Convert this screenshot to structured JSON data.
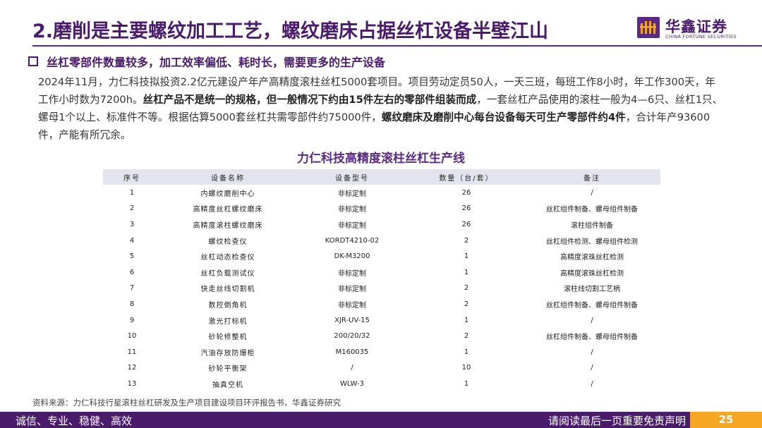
{
  "header": {
    "title": "2.磨削是主要螺纹加工工艺，螺纹磨床占据丝杠设备半壁江山",
    "logo_cn": "华鑫证券",
    "logo_en": "CHINA FORTUNE SECURITIES"
  },
  "subheading": "丝杠零部件数量较多，加工效率偏低、耗时长，需要更多的生产设备",
  "paragraph": {
    "p1": "2024年11月，力仁科技拟投资2.2亿元建设产年产高精度滚柱丝杠5000套项目。项目劳动定员50人，一天三班，每班工作8小时，年工作300天，年工作小时数为7200h。",
    "b1": "丝杠产品不是统一的规格，但一般情况下约由15件左右的零部件组装而成",
    "p2": "，一套丝杠产品使用的滚柱一般为4—6只、丝杠1只、螺母1个以上、标准件不等。根据估算5000套丝杠共需零部件约75000件，",
    "b2": "螺纹磨床及磨削中心每台设备每天可生产零部件约4件",
    "p3": "，合计年产93600件，产能有所冗余。"
  },
  "table": {
    "title": "力仁科技高精度滚柱丝杠生产线",
    "headers": [
      "序号",
      "设备名称",
      "设备型号",
      "数量（台/套）",
      "备注"
    ],
    "rows": [
      [
        "1",
        "内螺纹磨削中心",
        "非标定制",
        "26",
        "/"
      ],
      [
        "2",
        "高精度丝杠螺纹磨床",
        "非标定制",
        "26",
        "丝杠组件制备、螺母组件制备"
      ],
      [
        "3",
        "高精度滚柱螺纹磨床",
        "非标定制",
        "26",
        "滚柱组件制备"
      ],
      [
        "4",
        "螺纹检查仪",
        "KORDT4210-02",
        "2",
        "丝杠组件检测、螺母组件检测"
      ],
      [
        "5",
        "丝杠动态检查仪",
        "DK-M3200",
        "1",
        "高精度滚珠丝杠检测"
      ],
      [
        "6",
        "丝杠负载测试仪",
        "非标定制",
        "1",
        "高精度滚珠丝杠检测"
      ],
      [
        "7",
        "快走丝线切割机",
        "非标定制",
        "2",
        "滚柱线切割工艺柄"
      ],
      [
        "8",
        "数控倒角机",
        "非标定制",
        "2",
        "丝杠组件制备、螺母组件制备"
      ],
      [
        "9",
        "激光打标机",
        "XJR-UV-15",
        "1",
        "/"
      ],
      [
        "10",
        "砂轮修整机",
        "200/20/32",
        "2",
        "丝杠组件制备、螺母组件制备"
      ],
      [
        "11",
        "汽油存放防爆柜",
        "M160035",
        "1",
        "/"
      ],
      [
        "12",
        "砂轮平衡架",
        "/",
        "10",
        "/"
      ],
      [
        "13",
        "抽真空机",
        "WLW-3",
        "1",
        "/"
      ]
    ]
  },
  "source": "资料来源：力仁科技行星滚柱丝杠研发及生产项目建设项目环评报告书，华鑫证券研究",
  "footer": {
    "left": "诚信、专业、稳健、高效",
    "right": "请阅读最后一页重要免责声明",
    "page": "25"
  }
}
